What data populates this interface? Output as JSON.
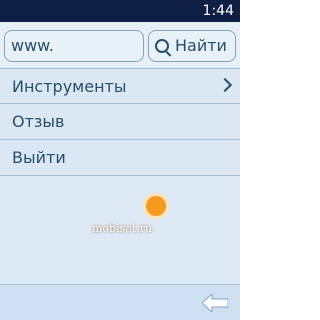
{
  "status_bar": {
    "time": "1:44"
  },
  "browser": {
    "url_value": "www.",
    "search_button_label": "Найти"
  },
  "menu": {
    "items": [
      {
        "label": "Инструменты",
        "has_submenu": true
      },
      {
        "label": "Отзыв",
        "has_submenu": false
      },
      {
        "label": "Выйти",
        "has_submenu": false
      }
    ]
  },
  "watermark": {
    "text": "mobiset.ru"
  },
  "icons": {
    "search": "search-icon",
    "chevron": "chevron-right-icon",
    "back": "back-arrow-icon"
  },
  "colors": {
    "status_bar": "#0f1f44",
    "background": "#dce8f3",
    "text": "#24506f"
  }
}
